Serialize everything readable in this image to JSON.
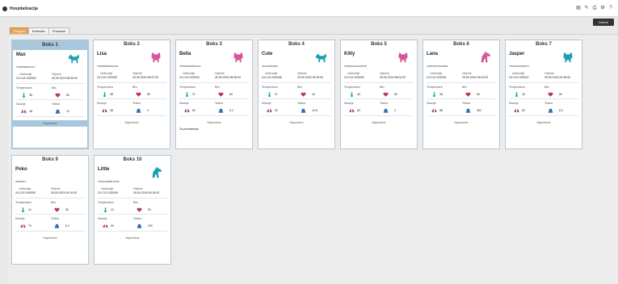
{
  "app": {
    "title": "Hospitalizacija",
    "close_label": "Zatvori"
  },
  "tabs": [
    "Pregled",
    "Kalendar",
    "Postavke"
  ],
  "labels": {
    "admission": "Uzdizanje",
    "time": "Vrijeme",
    "temperature": "Temperatura",
    "pulse": "Bilo",
    "respiration": "Disanje",
    "weight": "Težina",
    "notes": "Napomene"
  },
  "colors": {
    "teal": "#1e9fb6",
    "pink": "#d6569c",
    "heart": "#b6384a",
    "lungs": "#a63a84",
    "weight": "#2b6fb8",
    "thermo": "#1aa79a",
    "selected": "#a9c7dc",
    "tab_active": "#e4a455"
  },
  "boxes": [
    {
      "box": "Boks 1",
      "name": "Max",
      "id": "7050098494614?",
      "adm": "24-CLE-000002",
      "time": "26.09.2024 08:30:00",
      "temp": "38",
      "pulse": "80",
      "resp": "48",
      "weight": "12",
      "animal": "dog",
      "color": "teal",
      "note": ""
    },
    {
      "box": "Boks 2",
      "name": "Lisa",
      "id": "7050558963494118",
      "adm": "24-CLE-000005",
      "time": "26.09.2024 08:57:00",
      "temp": "38",
      "pulse": "50",
      "resp": "58",
      "weight": "4",
      "animal": "cat",
      "color": "pink",
      "note": ""
    },
    {
      "box": "Boks 3",
      "name": "Bella",
      "id": "7050000000001119",
      "adm": "24-CLE-000004",
      "time": "26.09.2024 08:38:00",
      "temp": "37",
      "pulse": "60",
      "resp": "60",
      "weight": "5.2",
      "animal": "cat",
      "color": "pink",
      "note": "Za promatranje"
    },
    {
      "box": "Boks 4",
      "name": "Cute",
      "id": "232100000002",
      "adm": "24-CLE-000006",
      "time": "25.09.2024 09:40:00",
      "temp": "37",
      "pulse": "40",
      "resp": "50",
      "weight": "14.5",
      "animal": "dog",
      "color": "teal",
      "note": ""
    },
    {
      "box": "Boks 5",
      "name": "Kitty",
      "id": "70502031111230678",
      "adm": "24-CLE-000003",
      "time": "26.09.2024 08:02:00",
      "temp": "40",
      "pulse": "50",
      "resp": "60",
      "weight": "3",
      "animal": "cat",
      "color": "pink",
      "note": ""
    },
    {
      "box": "Boks 6",
      "name": "Lana",
      "id": "7060016079128841",
      "adm": "24-CLE-000001",
      "time": "26.09.2024 09:04:00",
      "temp": "38",
      "pulse": "50",
      "resp": "58",
      "weight": "352",
      "animal": "horse",
      "color": "pink",
      "note": ""
    },
    {
      "box": "Boks 7",
      "name": "Jasper",
      "id": "7050100000008??",
      "adm": "24-CLE-000007",
      "time": "26.09.2024 09:08:00",
      "temp": "40",
      "pulse": "60",
      "resp": "60",
      "weight": "8.2",
      "animal": "cat",
      "color": "teal",
      "note": ""
    },
    {
      "box": "Boks 9",
      "name": "Poko",
      "id": "00000017",
      "adm": "24-CLE-000008",
      "time": "26.09.2024 09:10:00",
      "temp": "41",
      "pulse": "80",
      "resp": "70",
      "weight": "6.2",
      "animal": "",
      "color": "teal",
      "note": ""
    },
    {
      "box": "Boks 10",
      "name": "Little",
      "id": "7050102888016?66",
      "adm": "24-CLE-000009",
      "time": "26.09.2024 09:15:00",
      "temp": "41",
      "pulse": "50",
      "resp": "60",
      "weight": "200",
      "animal": "horse",
      "color": "teal",
      "note": ""
    }
  ]
}
